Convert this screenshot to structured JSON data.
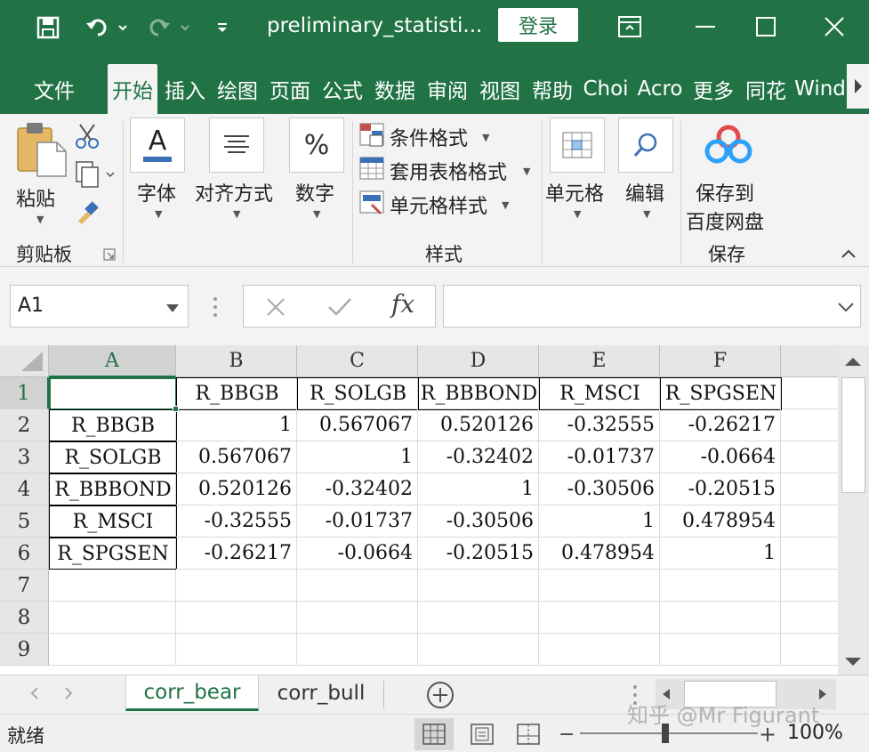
{
  "app": {
    "title": "preliminary_statisti...",
    "login_label": "登录"
  },
  "tabs": [
    {
      "label": "文件"
    },
    {
      "label": "开始"
    },
    {
      "label": "插入"
    },
    {
      "label": "绘图"
    },
    {
      "label": "页面"
    },
    {
      "label": "公式"
    },
    {
      "label": "数据"
    },
    {
      "label": "审阅"
    },
    {
      "label": "视图"
    },
    {
      "label": "帮助"
    },
    {
      "label": "Choi"
    },
    {
      "label": "Acro"
    },
    {
      "label": "更多"
    },
    {
      "label": "同花"
    },
    {
      "label": "Wind"
    }
  ],
  "ribbon": {
    "paste": "粘贴",
    "clipboard_group": "剪贴板",
    "font": "字体",
    "align": "对齐方式",
    "number": "数字",
    "conditional": "条件格式",
    "table_format": "套用表格格式",
    "cell_style": "单元格样式",
    "styles_group": "样式",
    "cells": "单元格",
    "edit": "编辑",
    "save_line1": "保存到",
    "save_line2": "百度网盘",
    "save_group": "保存",
    "font_icon": "A",
    "number_icon": "%"
  },
  "formula_bar": {
    "name_box": "A1",
    "fx": "fx",
    "formula": ""
  },
  "grid": {
    "columns": [
      "A",
      "B",
      "C",
      "D",
      "E",
      "F"
    ],
    "rows": [
      "1",
      "2",
      "3",
      "4",
      "5",
      "6",
      "7",
      "8",
      "9"
    ],
    "header_row": [
      "",
      "R_BBGB",
      "R_SOLGB",
      "R_BBBOND",
      "R_MSCI",
      "R_SPGSEN"
    ],
    "data": [
      [
        "R_BBGB",
        "1",
        "0.567067",
        "0.520126",
        "-0.32555",
        "-0.26217"
      ],
      [
        "R_SOLGB",
        "0.567067",
        "1",
        "-0.32402",
        "-0.01737",
        "-0.0664"
      ],
      [
        "R_BBBOND",
        "0.520126",
        "-0.32402",
        "1",
        "-0.30506",
        "-0.20515"
      ],
      [
        "R_MSCI",
        "-0.32555",
        "-0.01737",
        "-0.30506",
        "1",
        "0.478954"
      ],
      [
        "R_SPGSEN",
        "-0.26217",
        "-0.0664",
        "-0.20515",
        "0.478954",
        "1"
      ]
    ]
  },
  "sheets": [
    {
      "label": "corr_bear"
    },
    {
      "label": "corr_bull"
    }
  ],
  "status": {
    "ready": "就绪",
    "zoom": "100%"
  },
  "watermark": "知乎 @Mr Figurant",
  "colors": {
    "brand": "#217346",
    "grid_border": "#000000"
  }
}
